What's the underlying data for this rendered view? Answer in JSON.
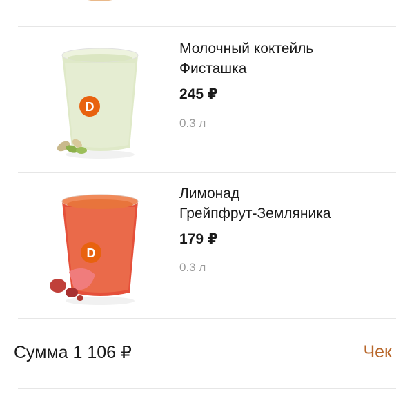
{
  "items": [
    {
      "icon": "pistachio-milkshake-image",
      "title_line1": "Молочный коктейль",
      "title_line2": "Фисташка",
      "price": "245 ₽",
      "volume": "0.3 л"
    },
    {
      "icon": "grapefruit-strawberry-lemonade-image",
      "title_line1": "Лимонад",
      "title_line2": "Грейпфрут-Земляника",
      "price": "179 ₽",
      "volume": "0.3 л"
    }
  ],
  "summary": {
    "sum_label": "Сумма 1 106 ₽",
    "check_label": "Чек"
  },
  "colors": {
    "accent": "#b8672b",
    "muted": "#9a9a9a",
    "divider": "#e6e6e6",
    "brand_orange": "#e8620f"
  }
}
